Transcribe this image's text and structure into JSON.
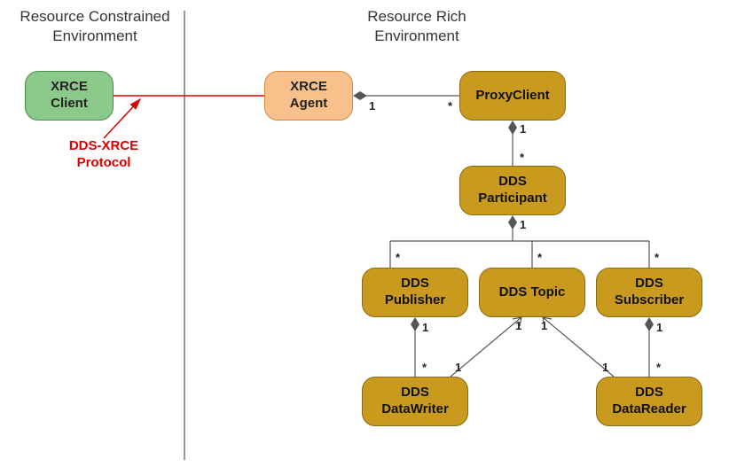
{
  "env": {
    "left_title": "Resource Constrained\nEnvironment",
    "right_title": "Resource Rich\nEnvironment"
  },
  "protocol_label": "DDS-XRCE\nProtocol",
  "nodes": {
    "xrce_client": "XRCE\nClient",
    "xrce_agent": "XRCE\nAgent",
    "proxy_client": "ProxyClient",
    "dds_participant": "DDS\nParticipant",
    "dds_publisher": "DDS\nPublisher",
    "dds_topic": "DDS Topic",
    "dds_subscriber": "DDS\nSubscriber",
    "dds_datawriter": "DDS\nDataWriter",
    "dds_datareader": "DDS\nDataReader"
  },
  "mult": {
    "one": "1",
    "star": "*"
  },
  "relationships": [
    {
      "from": "xrce_client",
      "to": "xrce_agent",
      "type": "association",
      "label": "DDS-XRCE Protocol"
    },
    {
      "from": "xrce_agent",
      "to": "proxy_client",
      "type": "composition",
      "from_mult": "1",
      "to_mult": "*"
    },
    {
      "from": "proxy_client",
      "to": "dds_participant",
      "type": "composition",
      "from_mult": "1",
      "to_mult": "*"
    },
    {
      "from": "dds_participant",
      "to": "dds_publisher",
      "type": "composition",
      "from_mult": "1",
      "to_mult": "*"
    },
    {
      "from": "dds_participant",
      "to": "dds_topic",
      "type": "composition",
      "from_mult": "1",
      "to_mult": "*"
    },
    {
      "from": "dds_participant",
      "to": "dds_subscriber",
      "type": "composition",
      "from_mult": "1",
      "to_mult": "*"
    },
    {
      "from": "dds_publisher",
      "to": "dds_datawriter",
      "type": "composition",
      "from_mult": "1",
      "to_mult": "*"
    },
    {
      "from": "dds_subscriber",
      "to": "dds_datareader",
      "type": "composition",
      "from_mult": "1",
      "to_mult": "*"
    },
    {
      "from": "dds_datawriter",
      "to": "dds_topic",
      "type": "association",
      "from_mult": "1",
      "to_mult": "1"
    },
    {
      "from": "dds_datareader",
      "to": "dds_topic",
      "type": "association",
      "from_mult": "1",
      "to_mult": "1"
    }
  ],
  "colors": {
    "green": "#8bc98b",
    "orange": "#f8c08a",
    "gold": "#c99a1e",
    "red": "#d00000",
    "line": "#555"
  }
}
